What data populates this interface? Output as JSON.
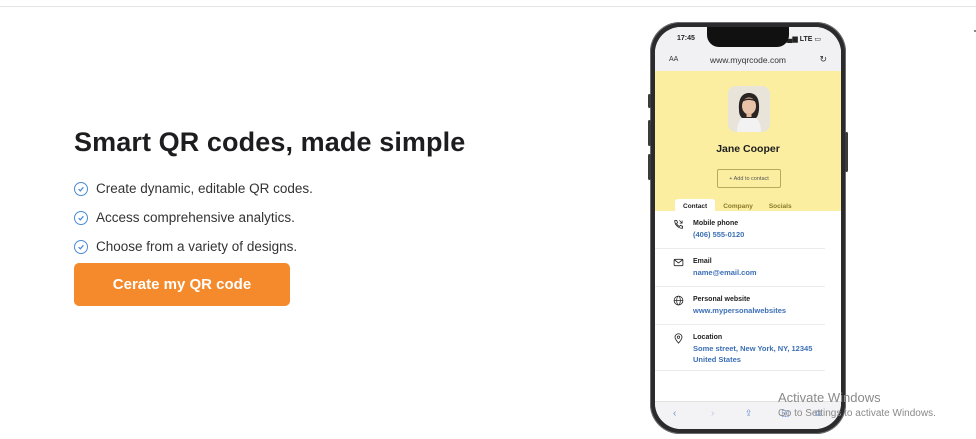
{
  "hero": {
    "title": "Smart QR codes, made simple",
    "features": [
      "Create dynamic, editable QR codes.",
      "Access comprehensive analytics.",
      "Choose from a variety of designs."
    ],
    "cta_label": "Cerate my QR code"
  },
  "phone": {
    "status_time": "17:45",
    "status_network": "LTE",
    "url_aa": "AA",
    "url": "www.myqrcode.com",
    "card": {
      "name": "Jane Cooper",
      "add_button": "+ Add to contact",
      "tabs": [
        "Contact",
        "Company",
        "Socials"
      ],
      "active_tab": "Contact"
    },
    "contacts": [
      {
        "icon": "phone-icon",
        "label": "Mobile phone",
        "value": "(406) 555-0120"
      },
      {
        "icon": "mail-icon",
        "label": "Email",
        "value": "name@email.com"
      },
      {
        "icon": "globe-icon",
        "label": "Personal website",
        "value": "www.mypersonalwebsites"
      },
      {
        "icon": "location-pin-icon",
        "label": "Location",
        "value": "Some street, New York, NY, 12345 United States"
      }
    ]
  },
  "watermark": {
    "title": "Activate Windows",
    "subtitle": "Go to Settings to activate Windows."
  },
  "colors": {
    "cta": "#f48a2c",
    "card_bg": "#fbeea0",
    "link": "#3c6fb6",
    "check": "#4a8bd6"
  }
}
